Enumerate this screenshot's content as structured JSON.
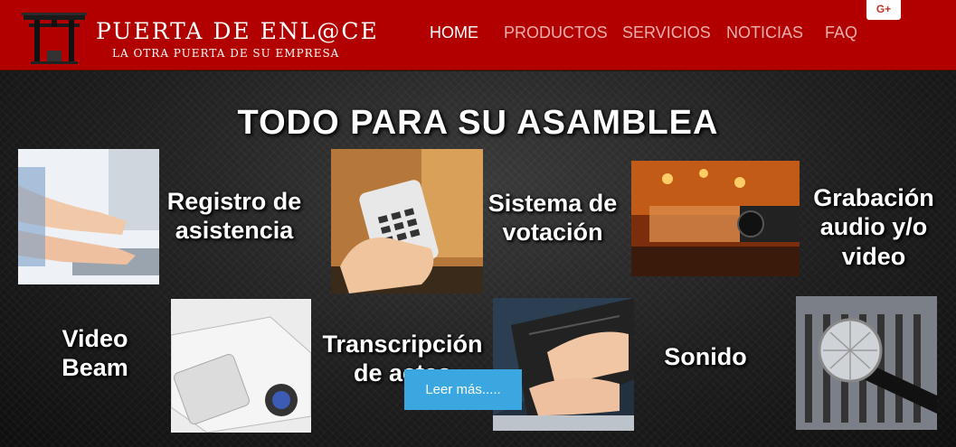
{
  "brand": {
    "title": "PUERTA DE ENL@CE",
    "subtitle": "LA OTRA PUERTA DE SU EMPRESA"
  },
  "nav": {
    "items": [
      {
        "label": "HOME",
        "active": true
      },
      {
        "label": "PRODUCTOS",
        "active": false
      },
      {
        "label": "SERVICIOS",
        "active": false
      },
      {
        "label": "NOTICIAS",
        "active": false
      },
      {
        "label": "FAQ",
        "active": false
      }
    ],
    "social": "G+"
  },
  "banner": {
    "title": "TODO PARA SU ASAMBLEA",
    "services": [
      {
        "label": "Registro de asistencia",
        "icon": "typing-hands-photo"
      },
      {
        "label": "Sistema de votación",
        "icon": "voting-remote-photo"
      },
      {
        "label": "Grabación audio y/o video",
        "icon": "video-camera-photo"
      },
      {
        "label": "Video Beam",
        "icon": "projector-photo"
      },
      {
        "label": "Transcripción de actas",
        "icon": "laptop-typing-photo"
      },
      {
        "label": "Sonido",
        "icon": "microphone-photo"
      }
    ],
    "button": "Leer más....."
  },
  "colors": {
    "header": "#b20000",
    "button": "#3aa7e0",
    "banner_bg": "#1e1e1e"
  }
}
